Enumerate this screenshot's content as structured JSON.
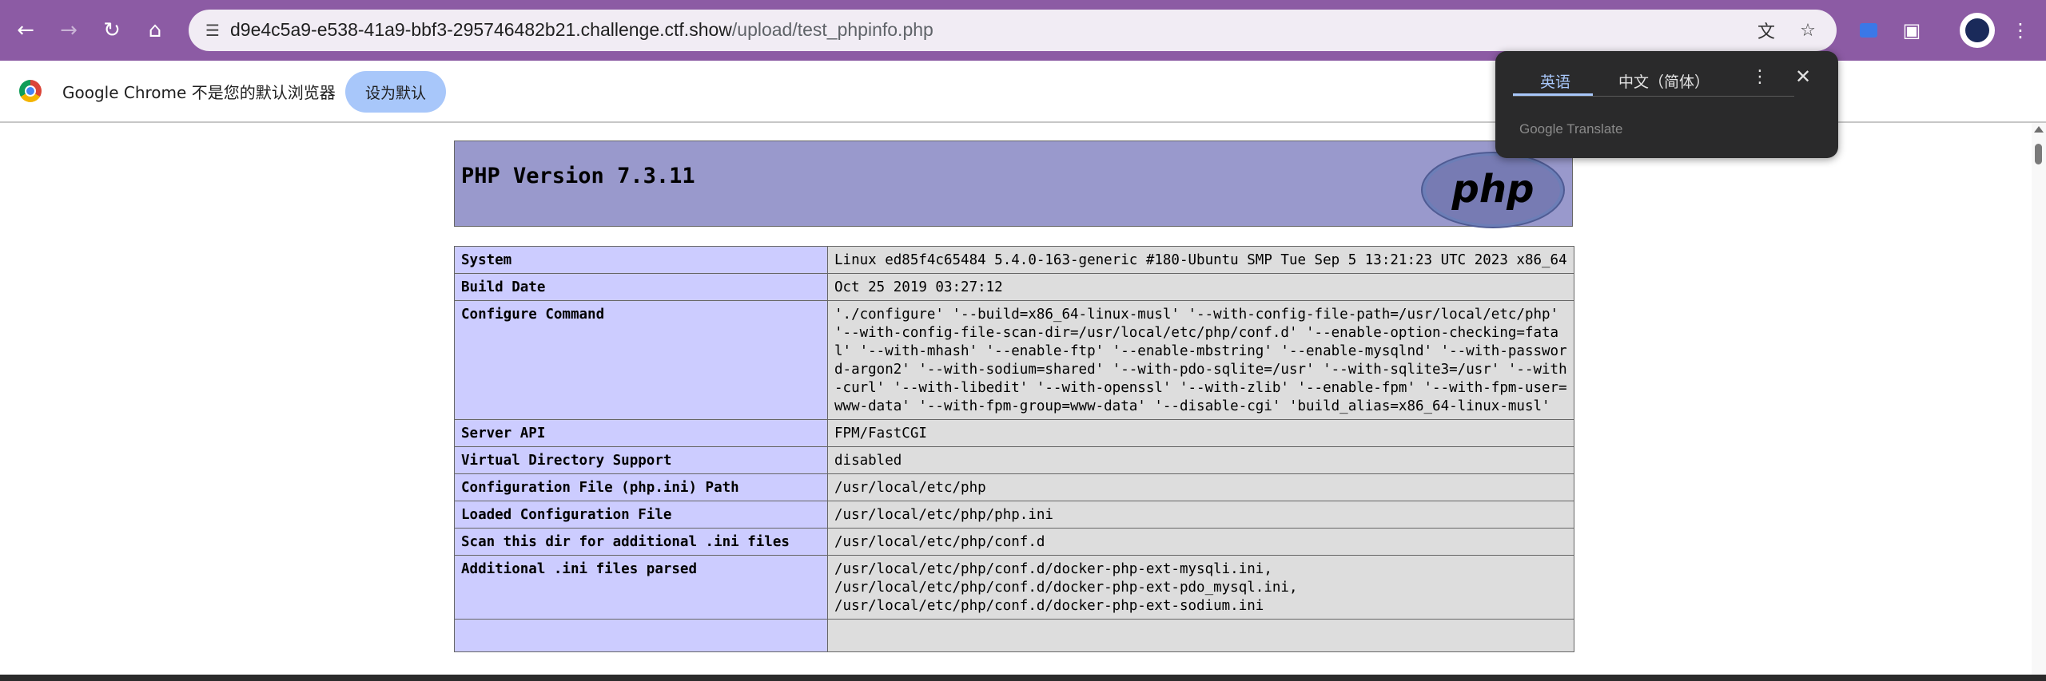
{
  "browser": {
    "url_host": "d9e4c5a9-e538-41a9-bbf3-295746482b21.challenge.ctf.show",
    "url_path": "/upload/test_phpinfo.php",
    "toolbar_color": "#8c5ba4",
    "icons": {
      "back": "back-arrow-icon",
      "forward": "forward-arrow-icon",
      "reload": "reload-icon",
      "home": "home-icon",
      "site_info": "site-info-icon",
      "translate": "translate-icon",
      "bookmark": "star-icon",
      "extensions": "puzzle-icon",
      "menu": "kebab-menu-icon"
    }
  },
  "infobar": {
    "message": "Google Chrome 不是您的默认浏览器",
    "button_label": "设为默认"
  },
  "translate_popup": {
    "tab_source": "英语",
    "tab_target": "中文（简体）",
    "brand": "Google Translate"
  },
  "php": {
    "title": "PHP Version 7.3.11",
    "logo_text": "php",
    "colors": {
      "header": "#9999cc",
      "label_cell": "#ccccff",
      "value_cell": "#dddddd"
    },
    "rows": [
      {
        "label": "System",
        "value": "Linux ed85f4c65484 5.4.0-163-generic #180-Ubuntu SMP Tue Sep 5 13:21:23 UTC 2023 x86_64"
      },
      {
        "label": "Build Date",
        "value": "Oct 25 2019 03:27:12"
      },
      {
        "label": "Configure Command",
        "value": "'./configure' '--build=x86_64-linux-musl' '--with-config-file-path=/usr/local/etc/php' '--with-config-file-scan-dir=/usr/local/etc/php/conf.d' '--enable-option-checking=fatal' '--with-mhash' '--enable-ftp' '--enable-mbstring' '--enable-mysqlnd' '--with-password-argon2' '--with-sodium=shared' '--with-pdo-sqlite=/usr' '--with-sqlite3=/usr' '--with-curl' '--with-libedit' '--with-openssl' '--with-zlib' '--enable-fpm' '--with-fpm-user=www-data' '--with-fpm-group=www-data' '--disable-cgi' 'build_alias=x86_64-linux-musl'"
      },
      {
        "label": "Server API",
        "value": "FPM/FastCGI"
      },
      {
        "label": "Virtual Directory Support",
        "value": "disabled"
      },
      {
        "label": "Configuration File (php.ini) Path",
        "value": "/usr/local/etc/php"
      },
      {
        "label": "Loaded Configuration File",
        "value": "/usr/local/etc/php/php.ini"
      },
      {
        "label": "Scan this dir for additional .ini files",
        "value": "/usr/local/etc/php/conf.d"
      },
      {
        "label": "Additional .ini files parsed",
        "value": "/usr/local/etc/php/conf.d/docker-php-ext-mysqli.ini,\n/usr/local/etc/php/conf.d/docker-php-ext-pdo_mysql.ini,\n/usr/local/etc/php/conf.d/docker-php-ext-sodium.ini"
      }
    ]
  }
}
